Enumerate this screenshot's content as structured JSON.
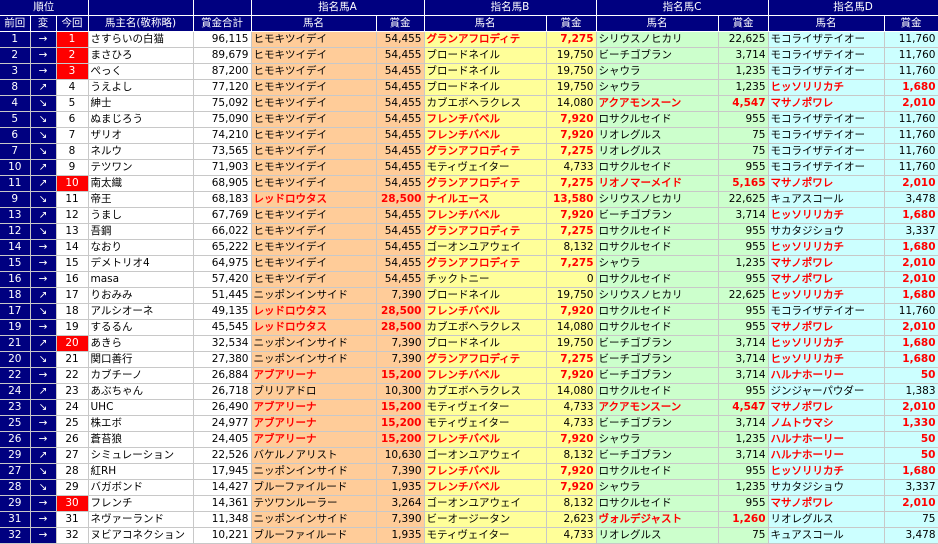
{
  "header": {
    "rank_group": "順位",
    "prev": "前回",
    "change": "変",
    "current": "今回",
    "owner": "馬主名(敬称略)",
    "total": "賞金合計",
    "horse_a": "指名馬A",
    "horse_b": "指名馬B",
    "horse_c": "指名馬C",
    "horse_d": "指名馬D",
    "horse_name": "馬名",
    "prize": "賞金"
  },
  "rows": [
    {
      "prev": "1",
      "dir": "→",
      "rank": "1",
      "owner": "さすらいの白猫",
      "total": "96,115",
      "a": "ヒモキツイデイ",
      "ap": "54,455",
      "b": "グランアフロディテ",
      "bp": "7,275",
      "c": "シリウスノヒカリ",
      "cp": "22,625",
      "d": "モコライザテイオー",
      "dp": "11,760",
      "ah": false,
      "bh": true,
      "ch": false,
      "dh": false
    },
    {
      "prev": "2",
      "dir": "→",
      "rank": "2",
      "owner": "まさひろ",
      "total": "89,679",
      "a": "ヒモキツイデイ",
      "ap": "54,455",
      "b": "ブロードネイル",
      "bp": "19,750",
      "c": "ビーチゴブラン",
      "cp": "3,714",
      "d": "モコライザテイオー",
      "dp": "11,760",
      "ah": false,
      "bh": false,
      "ch": false,
      "dh": false
    },
    {
      "prev": "3",
      "dir": "→",
      "rank": "3",
      "owner": "ぺっく",
      "total": "87,200",
      "a": "ヒモキツイデイ",
      "ap": "54,455",
      "b": "ブロードネイル",
      "bp": "19,750",
      "c": "シャウラ",
      "cp": "1,235",
      "d": "モコライザテイオー",
      "dp": "11,760",
      "ah": false,
      "bh": false,
      "ch": false,
      "dh": false
    },
    {
      "prev": "8",
      "dir": "↗",
      "rank": "4",
      "owner": "うえよし",
      "total": "77,120",
      "a": "ヒモキツイデイ",
      "ap": "54,455",
      "b": "ブロードネイル",
      "bp": "19,750",
      "c": "シャウラ",
      "cp": "1,235",
      "d": "ヒッソリリカチ",
      "dp": "1,680",
      "ah": false,
      "bh": false,
      "ch": false,
      "dh": true
    },
    {
      "prev": "4",
      "dir": "↘",
      "rank": "5",
      "owner": "紳士",
      "total": "75,092",
      "a": "ヒモキツイデイ",
      "ap": "54,455",
      "b": "カブエボヘラクレス",
      "bp": "14,080",
      "c": "アクアモンスーン",
      "cp": "4,547",
      "d": "マサノポワレ",
      "dp": "2,010",
      "ah": false,
      "bh": false,
      "ch": true,
      "dh": true
    },
    {
      "prev": "5",
      "dir": "↘",
      "rank": "6",
      "owner": "ぬまじろう",
      "total": "75,090",
      "a": "ヒモキツイデイ",
      "ap": "54,455",
      "b": "フレンチバベル",
      "bp": "7,920",
      "c": "ロサクルセイド",
      "cp": "955",
      "d": "モコライザテイオー",
      "dp": "11,760",
      "ah": false,
      "bh": true,
      "ch": false,
      "dh": false
    },
    {
      "prev": "6",
      "dir": "↘",
      "rank": "7",
      "owner": "ザリオ",
      "total": "74,210",
      "a": "ヒモキツイデイ",
      "ap": "54,455",
      "b": "フレンチバベル",
      "bp": "7,920",
      "c": "リオレグルス",
      "cp": "75",
      "d": "モコライザテイオー",
      "dp": "11,760",
      "ah": false,
      "bh": true,
      "ch": false,
      "dh": false
    },
    {
      "prev": "7",
      "dir": "↘",
      "rank": "8",
      "owner": "ネルウ",
      "total": "73,565",
      "a": "ヒモキツイデイ",
      "ap": "54,455",
      "b": "グランアフロディテ",
      "bp": "7,275",
      "c": "リオレグルス",
      "cp": "75",
      "d": "モコライザテイオー",
      "dp": "11,760",
      "ah": false,
      "bh": true,
      "ch": false,
      "dh": false
    },
    {
      "prev": "10",
      "dir": "↗",
      "rank": "9",
      "owner": "テツワン",
      "total": "71,903",
      "a": "ヒモキツイデイ",
      "ap": "54,455",
      "b": "モティヴェイター",
      "bp": "4,733",
      "c": "ロサクルセイド",
      "cp": "955",
      "d": "モコライザテイオー",
      "dp": "11,760",
      "ah": false,
      "bh": false,
      "ch": false,
      "dh": false
    },
    {
      "prev": "11",
      "dir": "↗",
      "rank": "10",
      "owner": "南太織",
      "total": "68,905",
      "a": "ヒモキツイデイ",
      "ap": "54,455",
      "b": "グランアフロディテ",
      "bp": "7,275",
      "c": "リオノマーメイド",
      "cp": "5,165",
      "d": "マサノポワレ",
      "dp": "2,010",
      "ah": false,
      "bh": true,
      "ch": true,
      "dh": true
    },
    {
      "prev": "9",
      "dir": "↘",
      "rank": "11",
      "owner": "帝王",
      "total": "68,183",
      "a": "レッドロウタス",
      "ap": "28,500",
      "b": "ナイルエース",
      "bp": "13,580",
      "c": "シリウスノヒカリ",
      "cp": "22,625",
      "d": "キュアスコール",
      "dp": "3,478",
      "ah": true,
      "bh": true,
      "ch": false,
      "dh": false
    },
    {
      "prev": "13",
      "dir": "↗",
      "rank": "12",
      "owner": "うまし",
      "total": "67,769",
      "a": "ヒモキツイデイ",
      "ap": "54,455",
      "b": "フレンチバベル",
      "bp": "7,920",
      "c": "ビーチゴブラン",
      "cp": "3,714",
      "d": "ヒッソリリカチ",
      "dp": "1,680",
      "ah": false,
      "bh": true,
      "ch": false,
      "dh": true
    },
    {
      "prev": "12",
      "dir": "↘",
      "rank": "13",
      "owner": "吾鋼",
      "total": "66,022",
      "a": "ヒモキツイデイ",
      "ap": "54,455",
      "b": "グランアフロディテ",
      "bp": "7,275",
      "c": "ロサクルセイド",
      "cp": "955",
      "d": "サカタジショウ",
      "dp": "3,337",
      "ah": false,
      "bh": true,
      "ch": false,
      "dh": false
    },
    {
      "prev": "14",
      "dir": "→",
      "rank": "14",
      "owner": "なおり",
      "total": "65,222",
      "a": "ヒモキツイデイ",
      "ap": "54,455",
      "b": "ゴーオンユアウェイ",
      "bp": "8,132",
      "c": "ロサクルセイド",
      "cp": "955",
      "d": "ヒッソリリカチ",
      "dp": "1,680",
      "ah": false,
      "bh": false,
      "ch": false,
      "dh": true
    },
    {
      "prev": "15",
      "dir": "→",
      "rank": "15",
      "owner": "デメトリオ4",
      "total": "64,975",
      "a": "ヒモキツイデイ",
      "ap": "54,455",
      "b": "グランアフロディテ",
      "bp": "7,275",
      "c": "シャウラ",
      "cp": "1,235",
      "d": "マサノポワレ",
      "dp": "2,010",
      "ah": false,
      "bh": true,
      "ch": false,
      "dh": true
    },
    {
      "prev": "16",
      "dir": "→",
      "rank": "16",
      "owner": "masa",
      "total": "57,420",
      "a": "ヒモキツイデイ",
      "ap": "54,455",
      "b": "チックトニー",
      "bp": "0",
      "c": "ロサクルセイド",
      "cp": "955",
      "d": "マサノポワレ",
      "dp": "2,010",
      "ah": false,
      "bh": false,
      "ch": false,
      "dh": true
    },
    {
      "prev": "18",
      "dir": "↗",
      "rank": "17",
      "owner": "りおみみ",
      "total": "51,445",
      "a": "ニッポンインサイド",
      "ap": "7,390",
      "b": "ブロードネイル",
      "bp": "19,750",
      "c": "シリウスノヒカリ",
      "cp": "22,625",
      "d": "ヒッソリリカチ",
      "dp": "1,680",
      "ah": false,
      "bh": false,
      "ch": false,
      "dh": true
    },
    {
      "prev": "17",
      "dir": "↘",
      "rank": "18",
      "owner": "アルシオーネ",
      "total": "49,135",
      "a": "レッドロウタス",
      "ap": "28,500",
      "b": "フレンチバベル",
      "bp": "7,920",
      "c": "ロサクルセイド",
      "cp": "955",
      "d": "モコライザテイオー",
      "dp": "11,760",
      "ah": true,
      "bh": true,
      "ch": false,
      "dh": false
    },
    {
      "prev": "19",
      "dir": "→",
      "rank": "19",
      "owner": "するるん",
      "total": "45,545",
      "a": "レッドロウタス",
      "ap": "28,500",
      "b": "カブエボヘラクレス",
      "bp": "14,080",
      "c": "ロサクルセイド",
      "cp": "955",
      "d": "マサノポワレ",
      "dp": "2,010",
      "ah": true,
      "bh": false,
      "ch": false,
      "dh": true
    },
    {
      "prev": "21",
      "dir": "↗",
      "rank": "20",
      "owner": "あきら",
      "total": "32,534",
      "a": "ニッポンインサイド",
      "ap": "7,390",
      "b": "ブロードネイル",
      "bp": "19,750",
      "c": "ビーチゴブラン",
      "cp": "3,714",
      "d": "ヒッソリリカチ",
      "dp": "1,680",
      "ah": false,
      "bh": false,
      "ch": false,
      "dh": true
    },
    {
      "prev": "20",
      "dir": "↘",
      "rank": "21",
      "owner": "関口善行",
      "total": "27,380",
      "a": "ニッポンインサイド",
      "ap": "7,390",
      "b": "グランアフロディテ",
      "bp": "7,275",
      "c": "ビーチゴブラン",
      "cp": "3,714",
      "d": "ヒッソリリカチ",
      "dp": "1,680",
      "ah": false,
      "bh": true,
      "ch": false,
      "dh": true
    },
    {
      "prev": "22",
      "dir": "→",
      "rank": "22",
      "owner": "カブチーノ",
      "total": "26,884",
      "a": "アブアリーナ",
      "ap": "15,200",
      "b": "フレンチバベル",
      "bp": "7,920",
      "c": "ビーチゴブラン",
      "cp": "3,714",
      "d": "ハルナホーリー",
      "dp": "50",
      "ah": true,
      "bh": true,
      "ch": false,
      "dh": true
    },
    {
      "prev": "24",
      "dir": "↗",
      "rank": "23",
      "owner": "あぶちゃん",
      "total": "26,718",
      "a": "ブリリアドロ",
      "ap": "10,300",
      "b": "カブエボヘラクレス",
      "bp": "14,080",
      "c": "ロサクルセイド",
      "cp": "955",
      "d": "ジンジャーパウダー",
      "dp": "1,383",
      "ah": false,
      "bh": false,
      "ch": false,
      "dh": false
    },
    {
      "prev": "23",
      "dir": "↘",
      "rank": "24",
      "owner": "UHC",
      "total": "26,490",
      "a": "アブアリーナ",
      "ap": "15,200",
      "b": "モティヴェイター",
      "bp": "4,733",
      "c": "アクアモンスーン",
      "cp": "4,547",
      "d": "マサノポワレ",
      "dp": "2,010",
      "ah": true,
      "bh": false,
      "ch": true,
      "dh": true
    },
    {
      "prev": "25",
      "dir": "→",
      "rank": "25",
      "owner": "株エボ",
      "total": "24,977",
      "a": "アブアリーナ",
      "ap": "15,200",
      "b": "モティヴェイター",
      "bp": "4,733",
      "c": "ビーチゴブラン",
      "cp": "3,714",
      "d": "ノムトウマシ",
      "dp": "1,330",
      "ah": true,
      "bh": false,
      "ch": false,
      "dh": true
    },
    {
      "prev": "26",
      "dir": "→",
      "rank": "26",
      "owner": "蒼苔狼",
      "total": "24,405",
      "a": "アブアリーナ",
      "ap": "15,200",
      "b": "フレンチバベル",
      "bp": "7,920",
      "c": "シャウラ",
      "cp": "1,235",
      "d": "ハルナホーリー",
      "dp": "50",
      "ah": true,
      "bh": true,
      "ch": false,
      "dh": true
    },
    {
      "prev": "29",
      "dir": "↗",
      "rank": "27",
      "owner": "シミュレーション",
      "total": "22,526",
      "a": "バケルノアリスト",
      "ap": "10,630",
      "b": "ゴーオンユアウェイ",
      "bp": "8,132",
      "c": "ビーチゴブラン",
      "cp": "3,714",
      "d": "ハルナホーリー",
      "dp": "50",
      "ah": false,
      "bh": false,
      "ch": false,
      "dh": true
    },
    {
      "prev": "27",
      "dir": "↘",
      "rank": "28",
      "owner": "紅RH",
      "total": "17,945",
      "a": "ニッポンインサイド",
      "ap": "7,390",
      "b": "フレンチバベル",
      "bp": "7,920",
      "c": "ロサクルセイド",
      "cp": "955",
      "d": "ヒッソリリカチ",
      "dp": "1,680",
      "ah": false,
      "bh": true,
      "ch": false,
      "dh": true
    },
    {
      "prev": "28",
      "dir": "↘",
      "rank": "29",
      "owner": "バガボンド",
      "total": "14,427",
      "a": "ブルーファイルード",
      "ap": "1,935",
      "b": "フレンチバベル",
      "bp": "7,920",
      "c": "シャウラ",
      "cp": "1,235",
      "d": "サカタジショウ",
      "dp": "3,337",
      "ah": false,
      "bh": true,
      "ch": false,
      "dh": false
    },
    {
      "prev": "29",
      "dir": "→",
      "rank": "30",
      "owner": "フレンチ",
      "total": "14,361",
      "a": "テツワンルーラー",
      "ap": "3,264",
      "b": "ゴーオンユアウェイ",
      "bp": "8,132",
      "c": "ロサクルセイド",
      "cp": "955",
      "d": "マサノポワレ",
      "dp": "2,010",
      "ah": false,
      "bh": false,
      "ch": false,
      "dh": true
    },
    {
      "prev": "31",
      "dir": "→",
      "rank": "31",
      "owner": "ネヴァーランド",
      "total": "11,348",
      "a": "ニッポンインサイド",
      "ap": "7,390",
      "b": "ビーオージータン",
      "bp": "2,623",
      "c": "ヴォルデジャスト",
      "cp": "1,260",
      "d": "リオレグルス",
      "dp": "75",
      "ah": false,
      "bh": false,
      "ch": true,
      "dh": false
    },
    {
      "prev": "32",
      "dir": "→",
      "rank": "32",
      "owner": "ヌビアコネクション",
      "total": "10,221",
      "a": "ブルーファイルード",
      "ap": "1,935",
      "b": "モティヴェイター",
      "bp": "4,733",
      "c": "リオレグルス",
      "cp": "75",
      "d": "キュアスコール",
      "dp": "3,478",
      "ah": false,
      "bh": false,
      "ch": false,
      "dh": false
    }
  ]
}
